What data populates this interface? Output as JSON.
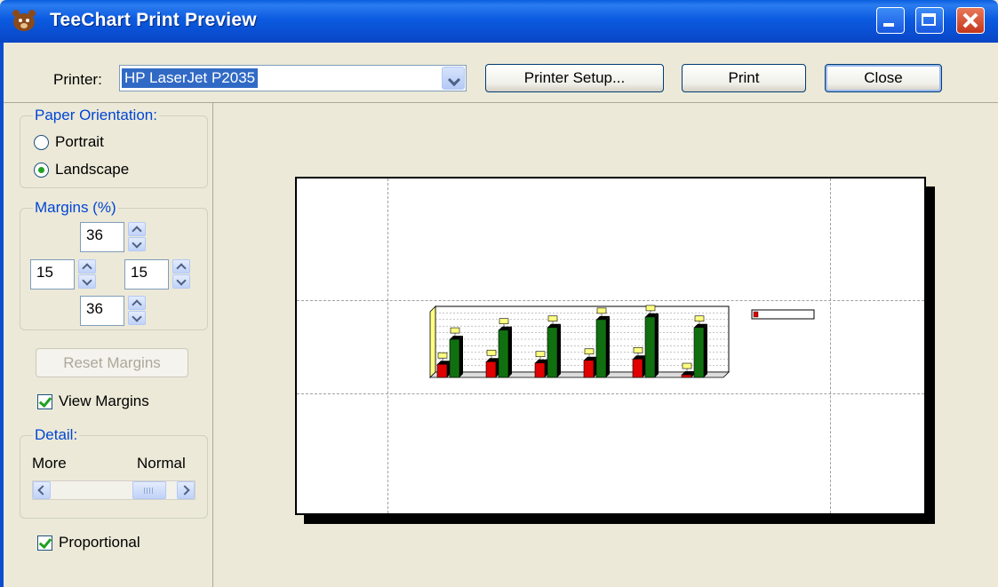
{
  "window": {
    "title": "TeeChart Print Preview"
  },
  "toolbar": {
    "printer_label": "Printer:",
    "printer_value": "HP LaserJet P2035",
    "printer_setup_label": "Printer Setup...",
    "print_label": "Print",
    "close_label": "Close"
  },
  "orientation": {
    "legend": "Paper Orientation:",
    "portrait_label": "Portrait",
    "landscape_label": "Landscape",
    "selected": "Landscape"
  },
  "margins": {
    "legend": "Margins (%)",
    "top": "36",
    "left": "15",
    "right": "15",
    "bottom": "36",
    "reset_label": "Reset Margins"
  },
  "view_margins": {
    "label": "View Margins",
    "checked": true
  },
  "detail": {
    "legend": "Detail:",
    "more_label": "More",
    "normal_label": "Normal",
    "slider_position": 0.78
  },
  "proportional": {
    "label": "Proportional",
    "checked": true
  },
  "colors": {
    "titlebar": "#0A4DD0",
    "accent": "#0046D5",
    "bar_red": "#E00000",
    "bar_green": "#107010",
    "marks": "#FFFF80"
  },
  "chart_data": {
    "type": "bar",
    "categories": [
      "",
      "",
      "",
      "",
      "",
      ""
    ],
    "series": [
      {
        "values": [
          1,
          1.2,
          1.1,
          1.3,
          1.4,
          0.2
        ]
      },
      {
        "values": [
          2.9,
          3.6,
          3.8,
          4.4,
          4.6,
          3.8
        ]
      }
    ],
    "ylim": [
      0,
      5
    ],
    "grid": true,
    "legend_position": "right"
  }
}
